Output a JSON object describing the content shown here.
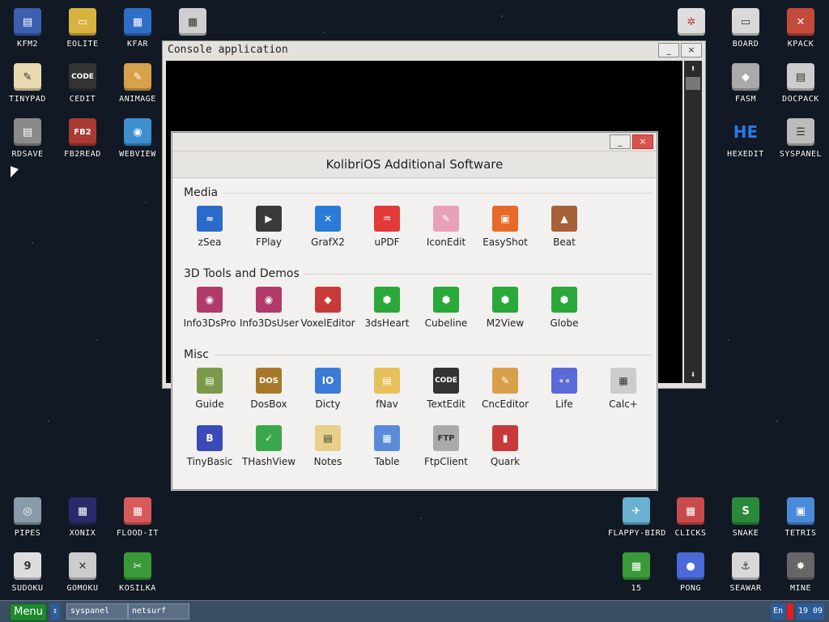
{
  "desktop_left": [
    {
      "label": "KFM2",
      "glyph": "▤",
      "bg": "#3d5fb0"
    },
    {
      "label": "EOLITE",
      "glyph": "▭",
      "bg": "#d9b33f"
    },
    {
      "label": "KFAR",
      "glyph": "▦",
      "bg": "#2f6fc8"
    },
    {
      "label": "TINYPAD",
      "glyph": "✎",
      "bg": "#e8d9b0"
    },
    {
      "label": "CEDIT",
      "glyph": "CODE",
      "bg": "#333333"
    },
    {
      "label": "ANIMAGE",
      "glyph": "✎",
      "bg": "#d8a04a"
    },
    {
      "label": "RDSAVE",
      "glyph": "▤",
      "bg": "#8a8a8a"
    },
    {
      "label": "FB2READ",
      "glyph": "FB2",
      "bg": "#a83a32"
    },
    {
      "label": "WEBVIEW",
      "glyph": "◉",
      "bg": "#3d8fcf"
    }
  ],
  "desktop_right": [
    {
      "label": "BOARD",
      "glyph": "▭",
      "bg": "#d8d8d8"
    },
    {
      "label": "KPACK",
      "glyph": "✕",
      "bg": "#c44a3a"
    },
    {
      "label": "FASM",
      "glyph": "◆",
      "bg": "#aaaaaa"
    },
    {
      "label": "DOCPACK",
      "glyph": "▤",
      "bg": "#cccccc"
    },
    {
      "label": "HEXEDIT",
      "glyph": "HE",
      "bg": "#1a64c8"
    },
    {
      "label": "SYSPANEL",
      "glyph": "☰",
      "bg": "#bbbbbb"
    }
  ],
  "desktop_bottom_left": [
    {
      "label": "PIPES",
      "glyph": "◎",
      "bg": "#8a9aaa"
    },
    {
      "label": "XONIX",
      "glyph": "▦",
      "bg": "#2a2a6a"
    },
    {
      "label": "FLOOD-IT",
      "glyph": "▦",
      "bg": "#d85a5a"
    },
    {
      "label": "SUDOKU",
      "glyph": "9",
      "bg": "#dddddd"
    },
    {
      "label": "GOMOKU",
      "glyph": "✕",
      "bg": "#cccccc"
    },
    {
      "label": "KOSILKA",
      "glyph": "✂",
      "bg": "#3a9a3a"
    }
  ],
  "desktop_bottom_right": [
    {
      "label": "FLAPPY-BIRD",
      "glyph": "✈",
      "bg": "#6ab0d0"
    },
    {
      "label": "CLICKS",
      "glyph": "▦",
      "bg": "#c84a4a"
    },
    {
      "label": "SNAKE",
      "glyph": "S",
      "bg": "#2a8a3a"
    },
    {
      "label": "TETRIS",
      "glyph": "▣",
      "bg": "#4a8ad8"
    },
    {
      "label": "15",
      "glyph": "▦",
      "bg": "#3a9a3a"
    },
    {
      "label": "PONG",
      "glyph": "●",
      "bg": "#4a6ad8"
    },
    {
      "label": "SEAWAR",
      "glyph": "⚓",
      "bg": "#d8d8d8"
    },
    {
      "label": "MINE",
      "glyph": "✸",
      "bg": "#666666"
    }
  ],
  "console": {
    "title": "Console application",
    "minimize": "_",
    "close": "×",
    "scroll_up": "⬆",
    "scroll_down": "⬇"
  },
  "dialog": {
    "title": "KolibriOS Additional Software",
    "minimize": "_",
    "close": "×",
    "sections": [
      {
        "title": "Media",
        "apps": [
          {
            "label": "zSea",
            "glyph": "≈",
            "bg": "#2a6ac8"
          },
          {
            "label": "FPlay",
            "glyph": "▶",
            "bg": "#3a3a3a"
          },
          {
            "label": "GrafX2",
            "glyph": "✕",
            "bg": "#2a7ad8"
          },
          {
            "label": "uPDF",
            "glyph": "♒",
            "bg": "#e03a3a"
          },
          {
            "label": "IconEdit",
            "glyph": "✎",
            "bg": "#e8a0b8"
          },
          {
            "label": "EasyShot",
            "glyph": "▣",
            "bg": "#e86a2a"
          },
          {
            "label": "Beat",
            "glyph": "▲",
            "bg": "#a8603a"
          }
        ]
      },
      {
        "title": "3D Tools and Demos",
        "apps": [
          {
            "label": "Info3DsPro",
            "glyph": "◉",
            "bg": "#b03a6a"
          },
          {
            "label": "Info3DsUser",
            "glyph": "◉",
            "bg": "#b03a6a"
          },
          {
            "label": "VoxelEditor",
            "glyph": "◆",
            "bg": "#c83a3a"
          },
          {
            "label": "3dsHeart",
            "glyph": "⬢",
            "bg": "#2aa83a"
          },
          {
            "label": "Cubeline",
            "glyph": "⬢",
            "bg": "#2aa83a"
          },
          {
            "label": "M2View",
            "glyph": "⬢",
            "bg": "#2aa83a"
          },
          {
            "label": "Globe",
            "glyph": "⬢",
            "bg": "#2aa83a"
          }
        ]
      },
      {
        "title": "Misc",
        "apps": [
          {
            "label": "Guide",
            "glyph": "▤",
            "bg": "#7a9a4a"
          },
          {
            "label": "DosBox",
            "glyph": "DOS",
            "bg": "#a8782a"
          },
          {
            "label": "Dicty",
            "glyph": "IO",
            "bg": "#3a7ad8"
          },
          {
            "label": "fNav",
            "glyph": "▤",
            "bg": "#e8c05a"
          },
          {
            "label": "TextEdit",
            "glyph": "CODE",
            "bg": "#333333"
          },
          {
            "label": "CncEditor",
            "glyph": "✎",
            "bg": "#d8a04a"
          },
          {
            "label": "Life",
            "glyph": "∘∘",
            "bg": "#5a6ad8"
          },
          {
            "label": "Calc+",
            "glyph": "▦",
            "bg": "#cccccc"
          },
          {
            "label": "TinyBasic",
            "glyph": "B",
            "bg": "#3a4ab8"
          },
          {
            "label": "THashView",
            "glyph": "✓",
            "bg": "#3aa84a"
          },
          {
            "label": "Notes",
            "glyph": "▤",
            "bg": "#e8d08a"
          },
          {
            "label": "Table",
            "glyph": "▦",
            "bg": "#5a8ad8"
          },
          {
            "label": "FtpClient",
            "glyph": "FTP",
            "bg": "#aaaaaa"
          },
          {
            "label": "Quark",
            "glyph": "▮",
            "bg": "#c83a3a"
          }
        ]
      }
    ]
  },
  "taskbar": {
    "menu": "Menu",
    "arrow": "⇕",
    "tasks": [
      "syspanel",
      "netsurf"
    ],
    "lang": "En",
    "clock": "19 09"
  }
}
